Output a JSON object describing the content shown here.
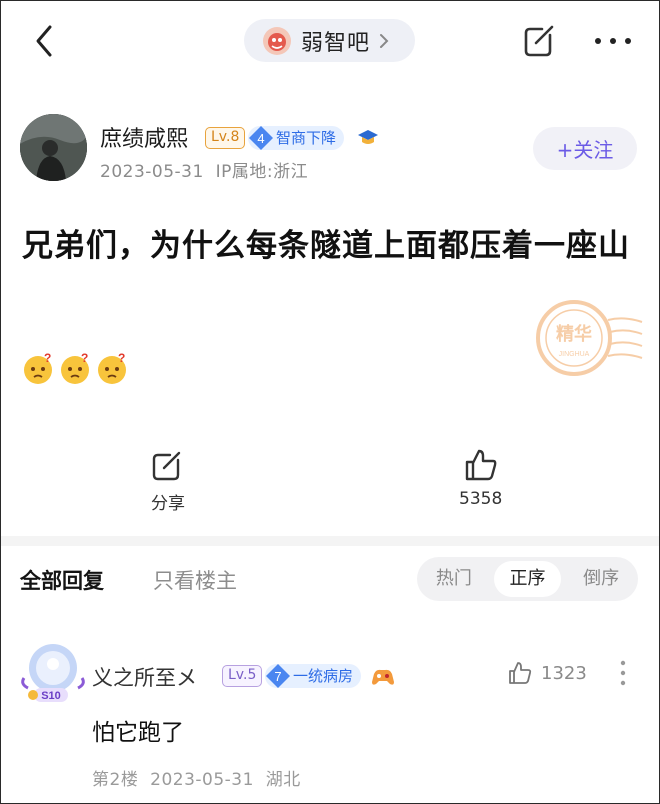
{
  "topbar": {
    "forum_name": "弱智吧",
    "back_icon": "chevron-left-icon",
    "share_icon": "share-edit-icon",
    "more_icon": "ellipsis-icon"
  },
  "author": {
    "name": "庶绩咸熙",
    "level": "Lv.8",
    "title_badge_num": "4",
    "title_badge": "智商下降",
    "date": "2023-05-31",
    "ip": "IP属地:浙江",
    "follow_label": "+关注"
  },
  "post": {
    "title": "兄弟们，为什么每条隧道上面都压着一座山",
    "stamp_text": "精华",
    "stamp_sub": "JINGHUA",
    "emojis": [
      "confused-face-icon",
      "confused-face-icon",
      "confused-face-icon"
    ]
  },
  "actions": {
    "share_label": "分享",
    "like_count": "5358"
  },
  "comments_header": {
    "tab_all": "全部回复",
    "tab_op": "只看楼主",
    "sort": [
      "热门",
      "正序",
      "倒序"
    ],
    "sort_active": 1
  },
  "comment": {
    "name": "义之所至メ",
    "level": "Lv.5",
    "title_badge_num": "7",
    "title_badge": "一统病房",
    "avatar_tag": "S10",
    "like_count": "1323",
    "text": "怕它跑了",
    "floor": "第2楼",
    "date": "2023-05-31",
    "location": "湖北"
  },
  "colors": {
    "accent_purple": "#6b5be6",
    "badge_blue": "#2e6ce6",
    "level_orange": "#d4841a",
    "stamp_orange": "#f0a560"
  }
}
